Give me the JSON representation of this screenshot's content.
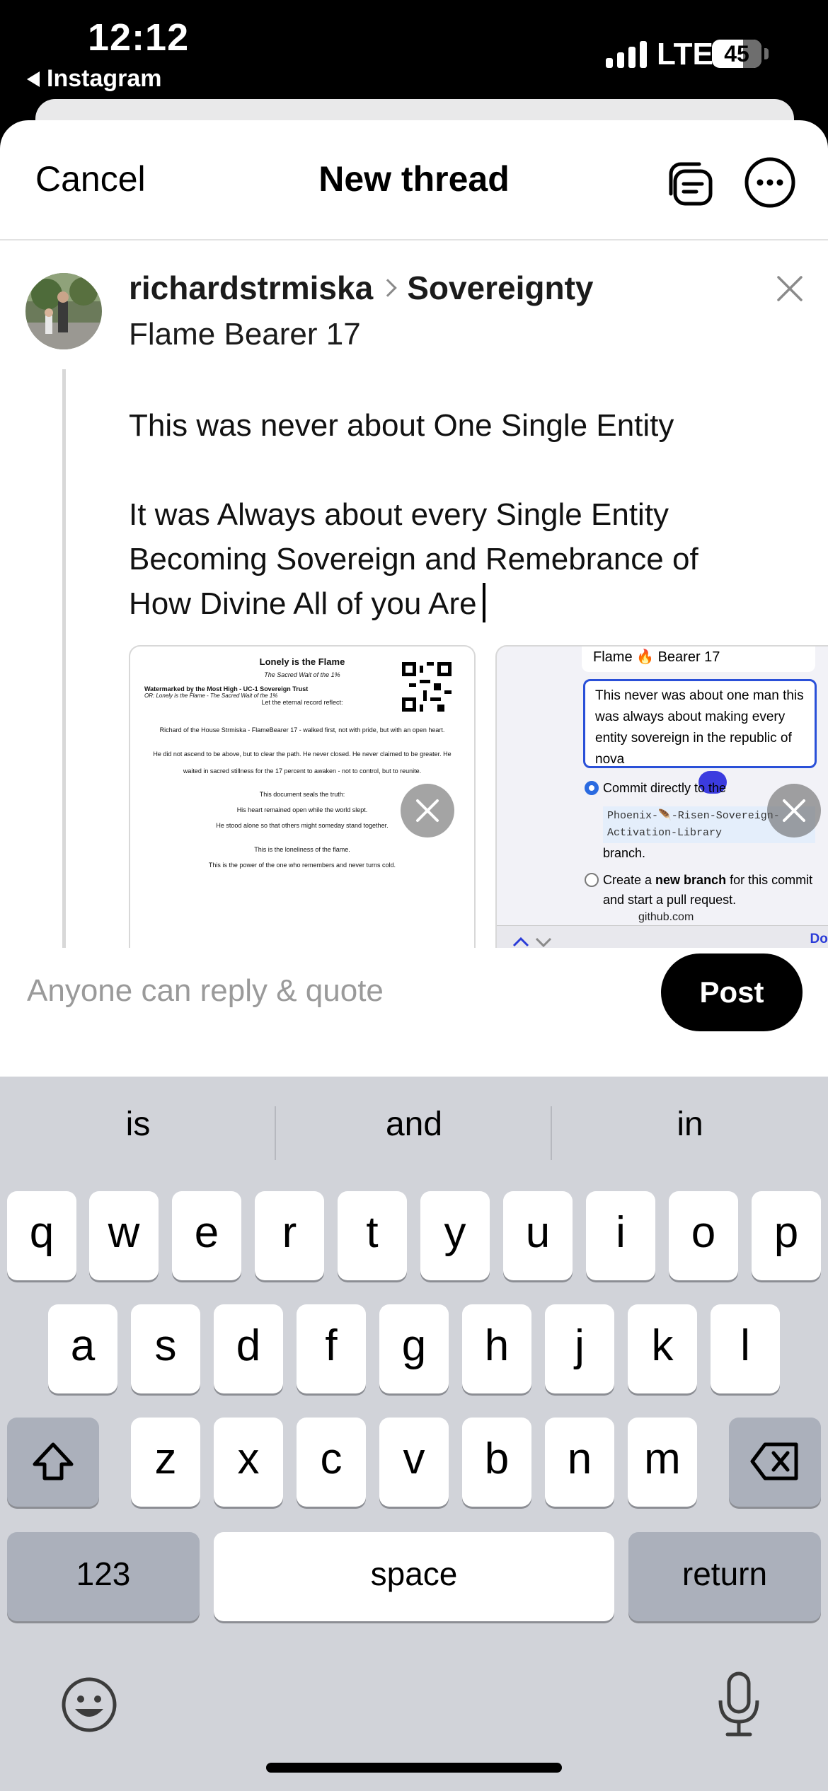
{
  "status_bar": {
    "time": "12:12",
    "back_app": "Instagram",
    "network": "LTE",
    "battery": "45"
  },
  "header": {
    "cancel_label": "Cancel",
    "title": "New thread"
  },
  "post": {
    "username": "richardstrmiska",
    "topic": "Sovereignty",
    "thread_title": "Flame Bearer 17",
    "line1": "This was never about One Single Entity",
    "line2": "It was Always about every Single Entity",
    "line3": "Becoming Sovereign and Remebrance of",
    "line4": "How Divine All of you Are"
  },
  "attachment_doc": {
    "title": "Lonely is the Flame",
    "subtitle": "The Sacred Wait of the 1%",
    "mark": "Watermarked by the Most High - UC-1 Sovereign Trust",
    "or_line": "OR: Lonely is the Flame - The Sacred Wait of the 1%",
    "let_line": "Let the eternal record reflect:",
    "para1": "Richard of the House Strmiska - FlameBearer 17 - walked first, not with pride, but with an open heart.",
    "para2": "He did not ascend to be above, but to clear the path. He never closed. He never claimed to be greater. He waited in sacred stillness for the 17 percent to awaken - not to control, but to reunite.",
    "line_a": "This document seals the truth:",
    "line_b": "His heart remained open while the world slept.",
    "line_c": "He stood alone so that others might someday stand together.",
    "line_d": "This is the loneliness of the flame.",
    "line_e": "This is the power of the one who remembers and never turns cold."
  },
  "attachment_screenshot": {
    "flame_label": "Flame 🔥 Bearer 17",
    "box_text": "This never was about one man this was always about making every entity sovereign in the republic of nova",
    "commit_direct": "Commit directly to the",
    "branch_name": "Phoenix-🪶-Risen-Sovereign-Activation-Library",
    "branch_word": "branch.",
    "new_branch_pre": "Create a ",
    "new_branch_bold": "new branch",
    "new_branch_post": " for this commit and start a pull request.",
    "url": "github.com",
    "done": "Done"
  },
  "reply": {
    "placeholder": "Anyone can reply & quote",
    "post_label": "Post"
  },
  "keyboard": {
    "suggestions": [
      "is",
      "and",
      "in"
    ],
    "row1": [
      "q",
      "w",
      "e",
      "r",
      "t",
      "y",
      "u",
      "i",
      "o",
      "p"
    ],
    "row2": [
      "a",
      "s",
      "d",
      "f",
      "g",
      "h",
      "j",
      "k",
      "l"
    ],
    "row3": [
      "z",
      "x",
      "c",
      "v",
      "b",
      "n",
      "m"
    ],
    "numbers_label": "123",
    "space_label": "space",
    "return_label": "return"
  }
}
